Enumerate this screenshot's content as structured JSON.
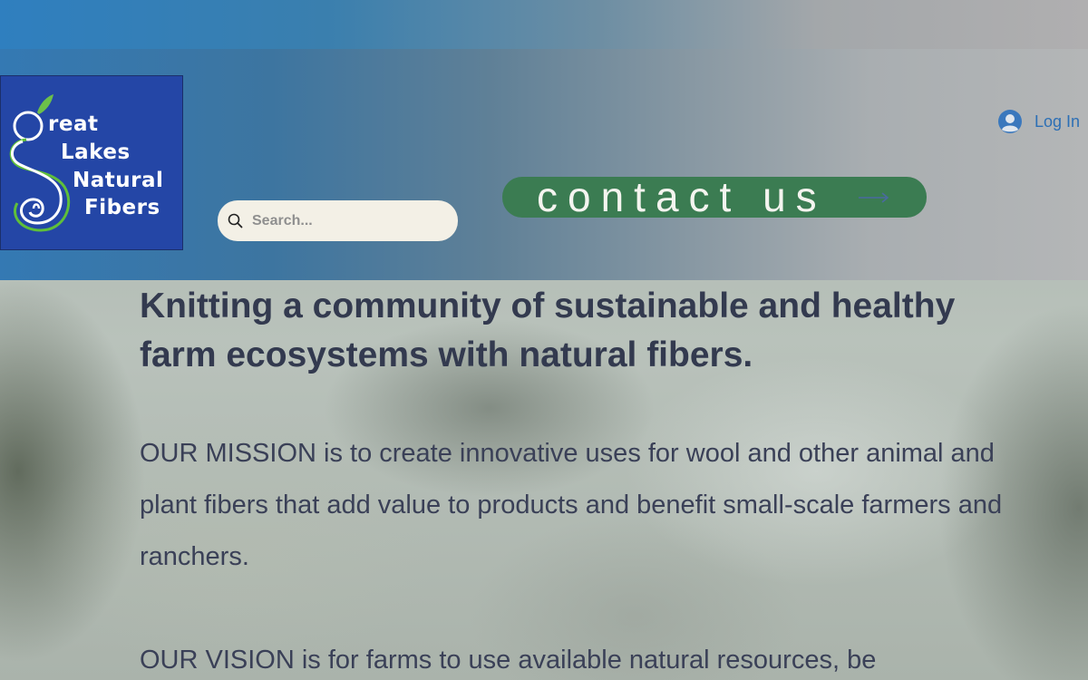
{
  "logo": {
    "alt": "Great Lakes Natural Fibers",
    "lines": [
      "reat",
      "Lakes",
      "Natural",
      "Fibers"
    ],
    "bg_color": "#2446a6"
  },
  "search": {
    "placeholder": "Search...",
    "icon": "search-icon"
  },
  "contact": {
    "label": "contact us",
    "icon": "arrow-right-icon",
    "bg_color": "#3b7c52"
  },
  "login": {
    "label": "Log In",
    "icon": "user-avatar-icon",
    "color": "#2c6fb5"
  },
  "main": {
    "headline": "Knitting a community of sustainable and healthy farm ecosystems with natural fibers.",
    "mission": "OUR MISSION is to create innovative uses for wool and other animal and plant fibers that add value to products and benefit small-scale farmers and ranchers.",
    "vision": "OUR VISION is for farms to use available natural resources, be"
  }
}
